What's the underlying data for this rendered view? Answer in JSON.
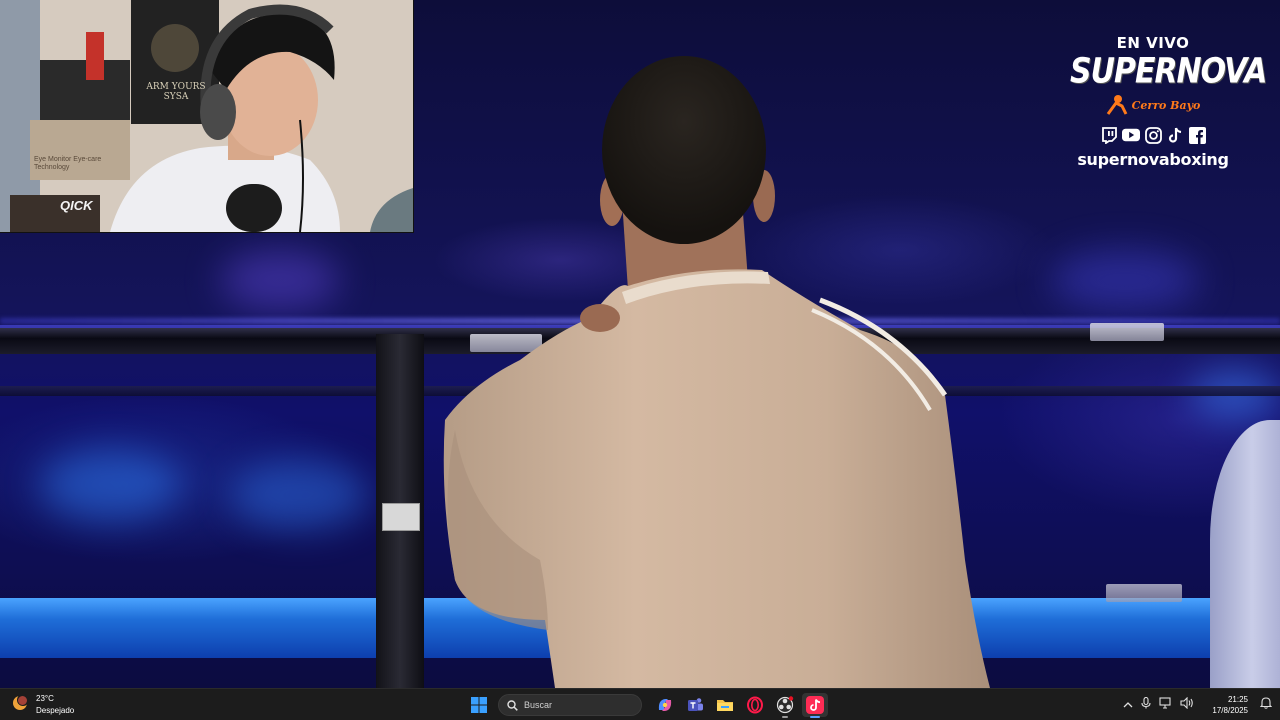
{
  "overlay": {
    "live_label": "EN VIVO",
    "brand_name": "SUPERNOVA",
    "sponsor_text": "Cerro Bayo",
    "social_icons": [
      "twitch-icon",
      "youtube-icon",
      "instagram-icon",
      "tiktok-icon",
      "facebook-icon"
    ],
    "handle": "supernovaboxing",
    "colors": {
      "text": "#ffffff",
      "sponsor_orange": "#ff7a1a"
    }
  },
  "webcam": {
    "poster_text": "ARM YOURS SYSA",
    "box_text": "Eye Monitor Eye-care Technology",
    "bag_text": "QICK"
  },
  "taskbar": {
    "weather": {
      "temperature": "23°C",
      "condition": "Despejado",
      "icon": "sun-moon-icon"
    },
    "start_icon": "windows-start-icon",
    "search_placeholder": "Buscar",
    "pinned_apps": [
      {
        "name": "copilot-icon",
        "active": false
      },
      {
        "name": "teams-icon",
        "active": false
      },
      {
        "name": "file-explorer-icon",
        "active": false
      },
      {
        "name": "opera-gx-icon",
        "active": false
      },
      {
        "name": "obs-studio-icon",
        "active": false
      },
      {
        "name": "tiktok-live-studio-icon",
        "active": true
      }
    ],
    "tray_icons": [
      "chevron-up-icon",
      "microphone-icon",
      "network-icon",
      "volume-icon"
    ],
    "clock": {
      "time": "21:25",
      "date": "17/8/2025"
    },
    "colors": {
      "background": "#1c1c1c",
      "windows_blue": "#3aa0ff"
    }
  }
}
